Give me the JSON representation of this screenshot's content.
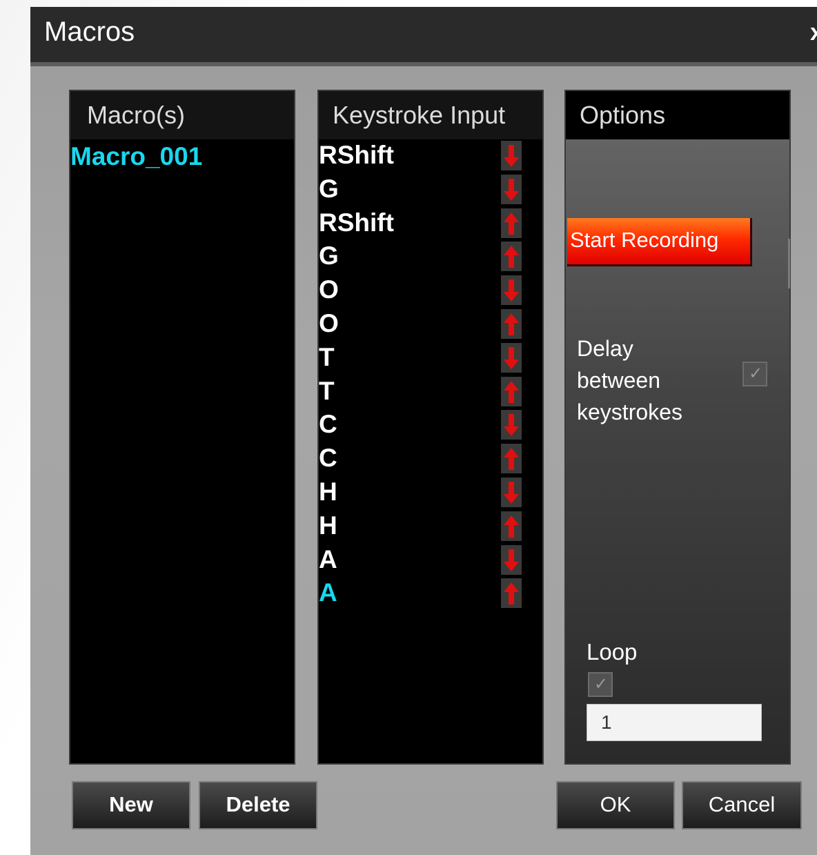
{
  "window": {
    "title": "Macros",
    "close_label": "x"
  },
  "macros_panel": {
    "header": "Macro(s)",
    "items": [
      "Macro_001"
    ]
  },
  "keystroke_panel": {
    "header": "Keystroke Input",
    "rows": [
      {
        "key": "RShift",
        "direction": "down"
      },
      {
        "key": "G",
        "direction": "down"
      },
      {
        "key": "RShift",
        "direction": "up"
      },
      {
        "key": "G",
        "direction": "up"
      },
      {
        "key": "O",
        "direction": "down"
      },
      {
        "key": "O",
        "direction": "up"
      },
      {
        "key": "T",
        "direction": "down"
      },
      {
        "key": "T",
        "direction": "up"
      },
      {
        "key": "C",
        "direction": "down"
      },
      {
        "key": "C",
        "direction": "up"
      },
      {
        "key": "H",
        "direction": "down"
      },
      {
        "key": "H",
        "direction": "up"
      },
      {
        "key": "A",
        "direction": "down"
      },
      {
        "key": "A",
        "direction": "up",
        "selected": true
      }
    ]
  },
  "options_panel": {
    "header": "Options",
    "record_button": "Start Recording",
    "delay_label": "Delay between keystrokes",
    "delay_checked": true,
    "loop_label": "Loop",
    "loop_checked": true,
    "loop_count": "1"
  },
  "buttons": {
    "new": "New",
    "delete": "Delete",
    "ok": "OK",
    "cancel": "Cancel"
  },
  "colors": {
    "accent_cyan": "#18d8ee",
    "arrow_red": "#e01010",
    "record_red": "#ff2b00"
  }
}
